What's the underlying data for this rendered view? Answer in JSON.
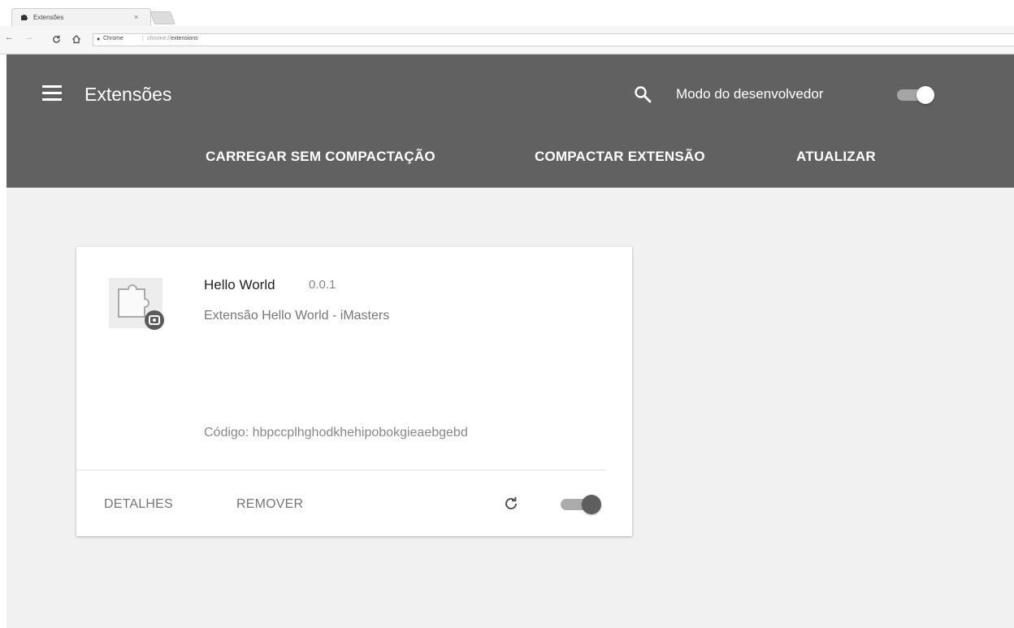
{
  "browser": {
    "tab_title": "Extensões",
    "tab_close": "×",
    "omnibox_origin": "Chrome",
    "omnibox_url_scheme": "chrome://",
    "omnibox_url_path": "extensions"
  },
  "header": {
    "title": "Extensões",
    "developer_mode_label": "Modo do desenvolvedor",
    "developer_mode_on": true,
    "buttons": {
      "load_unpacked": "CARREGAR SEM COMPACTAÇÃO",
      "pack_extension": "COMPACTAR EXTENSÃO",
      "update": "ATUALIZAR"
    }
  },
  "extension": {
    "name": "Hello World",
    "version": "0.0.1",
    "description": "Extensão Hello World - iMasters",
    "id_line": "Código: hbpccplhghodkhehipobokgieaebgebd",
    "details_label": "DETALHES",
    "remove_label": "REMOVER",
    "enabled": true
  },
  "colors": {
    "header_bg": "#616161",
    "page_bg": "#f1f1f1",
    "card_bg": "#ffffff",
    "toggle_knob_active": "#5e5e5e"
  },
  "icons": [
    "puzzle-icon",
    "hamburger-menu-icon",
    "search-icon",
    "reload-icon",
    "back-arrow-icon",
    "forward-arrow-icon",
    "home-icon"
  ]
}
